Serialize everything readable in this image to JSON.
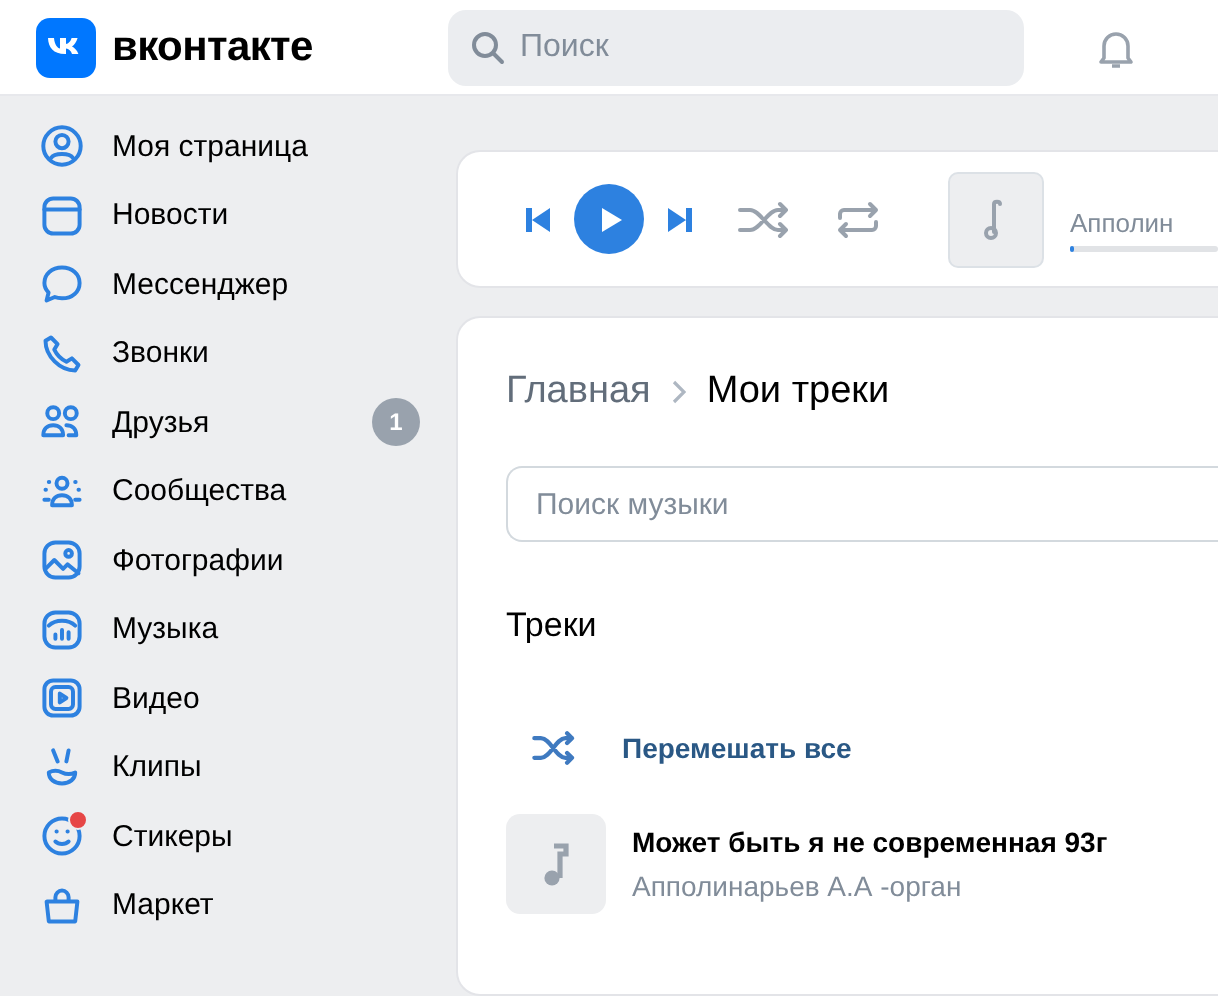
{
  "header": {
    "logo_text": "вконтакте",
    "search": {
      "placeholder": "Поиск"
    }
  },
  "sidebar": {
    "items": [
      {
        "label": "Моя страница",
        "selected": false
      },
      {
        "label": "Новости",
        "selected": false
      },
      {
        "label": "Мессенджер",
        "selected": false
      },
      {
        "label": "Звонки",
        "selected": false
      },
      {
        "label": "Друзья",
        "selected": false,
        "badge": "1"
      },
      {
        "label": "Сообщества",
        "selected": false
      },
      {
        "label": "Фотографии",
        "selected": false
      },
      {
        "label": "Музыка",
        "selected": false
      },
      {
        "label": "Видео",
        "selected": false
      },
      {
        "label": "Клипы",
        "selected": false
      },
      {
        "label": "Стикеры",
        "selected": false,
        "dot": true
      },
      {
        "label": "Маркет",
        "selected": false
      }
    ]
  },
  "player": {
    "playing": false,
    "artist": "Апполин",
    "level": 0.03
  },
  "music": {
    "breadcrumbs": [
      {
        "label": "Главная",
        "current": false
      },
      {
        "label": "Мои треки",
        "current": true
      }
    ],
    "search": {
      "placeholder": "Поиск музыки"
    },
    "section_title": "Треки",
    "shuffle_label": "Перемешать все",
    "tracks": [
      {
        "title": "Может быть я не современная 93г",
        "artist": "Апполинарьев А.А -орган"
      }
    ]
  }
}
